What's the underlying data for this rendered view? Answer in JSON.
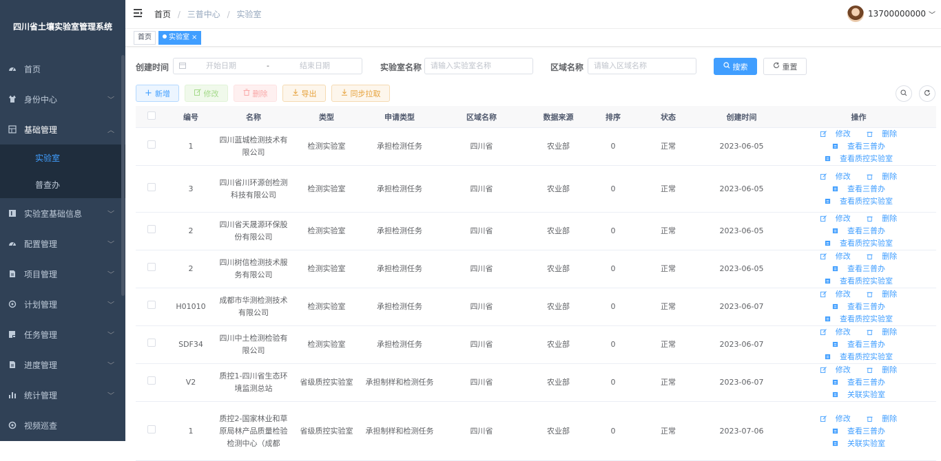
{
  "app_title": "四川省土壤实验室管理系统",
  "sidebar": {
    "items": [
      {
        "label": "首页",
        "icon": "dashboard-icon"
      },
      {
        "label": "身份中心",
        "icon": "shirt-icon",
        "arrow": "﹀"
      },
      {
        "label": "基础管理",
        "icon": "grid-icon",
        "arrow": "︿"
      },
      {
        "label": "实验室基础信息",
        "icon": "book-icon",
        "arrow": "﹀"
      },
      {
        "label": "配置管理",
        "icon": "dashboard-icon",
        "arrow": "﹀"
      },
      {
        "label": "项目管理",
        "icon": "document-icon",
        "arrow": "﹀"
      },
      {
        "label": "计划管理",
        "icon": "settings-icon",
        "arrow": "﹀"
      },
      {
        "label": "任务管理",
        "icon": "task-icon",
        "arrow": "﹀"
      },
      {
        "label": "进度管理",
        "icon": "document-icon",
        "arrow": "﹀"
      },
      {
        "label": "统计管理",
        "icon": "bar-chart-icon",
        "arrow": "﹀"
      },
      {
        "label": "视频巡查",
        "icon": "video-icon"
      }
    ],
    "sub_items": [
      {
        "label": "实验室"
      },
      {
        "label": "普查办"
      }
    ]
  },
  "header": {
    "breadcrumb": [
      "首页",
      "三普中心",
      "实验室"
    ],
    "separator": "/",
    "user": "13700000000",
    "user_arrow": "﹀"
  },
  "tags": {
    "home": "首页",
    "current": "实验室",
    "close": "×"
  },
  "filter": {
    "create_time_label": "创建时间",
    "start_placeholder": "开始日期",
    "range_sep": "-",
    "end_placeholder": "结束日期",
    "lab_name_label": "实验室名称",
    "lab_name_placeholder": "请输入实验室名称",
    "region_label": "区域名称",
    "region_placeholder": "请输入区域名称",
    "search": "搜索",
    "reset": "重置"
  },
  "toolbar": {
    "add": "新增",
    "edit": "修改",
    "delete": "删除",
    "export": "导出",
    "sync": "同步拉取"
  },
  "table": {
    "headers": [
      "编号",
      "名称",
      "类型",
      "申请类型",
      "区域名称",
      "数据来源",
      "排序",
      "状态",
      "创建时间",
      "操作"
    ],
    "rows": [
      {
        "code": "1",
        "name": "四川蓝城检测技术有限公司",
        "type": "检测实验室",
        "apply": "承担检测任务",
        "region": "四川省",
        "source": "农业部",
        "order": "0",
        "status": "正常",
        "date": "2023-06-05",
        "op_edit": "修改",
        "op_delete": "删除",
        "op_view": "查看三普办",
        "op_extra": "查看质控实验室"
      },
      {
        "code": "3",
        "name": "四川省川环源创检测科技有限公司",
        "type": "检测实验室",
        "apply": "承担检测任务",
        "region": "四川省",
        "source": "农业部",
        "order": "0",
        "status": "正常",
        "date": "2023-06-05",
        "op_edit": "修改",
        "op_delete": "删除",
        "op_view": "查看三普办",
        "op_extra": "查看质控实验室"
      },
      {
        "code": "2",
        "name": "四川省天晟源环保股份有限公司",
        "type": "检测实验室",
        "apply": "承担检测任务",
        "region": "四川省",
        "source": "农业部",
        "order": "0",
        "status": "正常",
        "date": "2023-06-05",
        "op_edit": "修改",
        "op_delete": "删除",
        "op_view": "查看三普办",
        "op_extra": "查看质控实验室"
      },
      {
        "code": "2",
        "name": "四川树信检测技术服务有限公司",
        "type": "检测实验室",
        "apply": "承担检测任务",
        "region": "四川省",
        "source": "农业部",
        "order": "0",
        "status": "正常",
        "date": "2023-06-05",
        "op_edit": "修改",
        "op_delete": "删除",
        "op_view": "查看三普办",
        "op_extra": "查看质控实验室"
      },
      {
        "code": "H01010",
        "name": "成都市华测检测技术有限公司",
        "type": "检测实验室",
        "apply": "承担检测任务",
        "region": "四川省",
        "source": "农业部",
        "order": "0",
        "status": "正常",
        "date": "2023-06-07",
        "op_edit": "修改",
        "op_delete": "删除",
        "op_view": "查看三普办",
        "op_extra": "查看质控实验室"
      },
      {
        "code": "SDF34",
        "name": "四川中土检测检验有限公司",
        "type": "检测实验室",
        "apply": "承担检测任务",
        "region": "四川省",
        "source": "农业部",
        "order": "0",
        "status": "正常",
        "date": "2023-06-07",
        "op_edit": "修改",
        "op_delete": "删除",
        "op_view": "查看三普办",
        "op_extra": "查看质控实验室"
      },
      {
        "code": "V2",
        "name": "质控1-四川省生态环境监测总站",
        "type": "省级质控实验室",
        "apply": "承担制样和检测任务",
        "region": "四川省",
        "source": "农业部",
        "order": "0",
        "status": "正常",
        "date": "2023-06-07",
        "op_edit": "修改",
        "op_delete": "删除",
        "op_view": "查看三普办",
        "op_extra": "关联实验室"
      },
      {
        "code": "1",
        "name": "质控2-国家林业和草原局林产品质量检验检测中心（成都",
        "type": "省级质控实验室",
        "apply": "承担制样和检测任务",
        "region": "四川省",
        "source": "农业部",
        "order": "0",
        "status": "正常",
        "date": "2023-07-06",
        "op_edit": "修改",
        "op_delete": "删除",
        "op_view": "查看三普办",
        "op_extra": "关联实验室"
      }
    ]
  }
}
